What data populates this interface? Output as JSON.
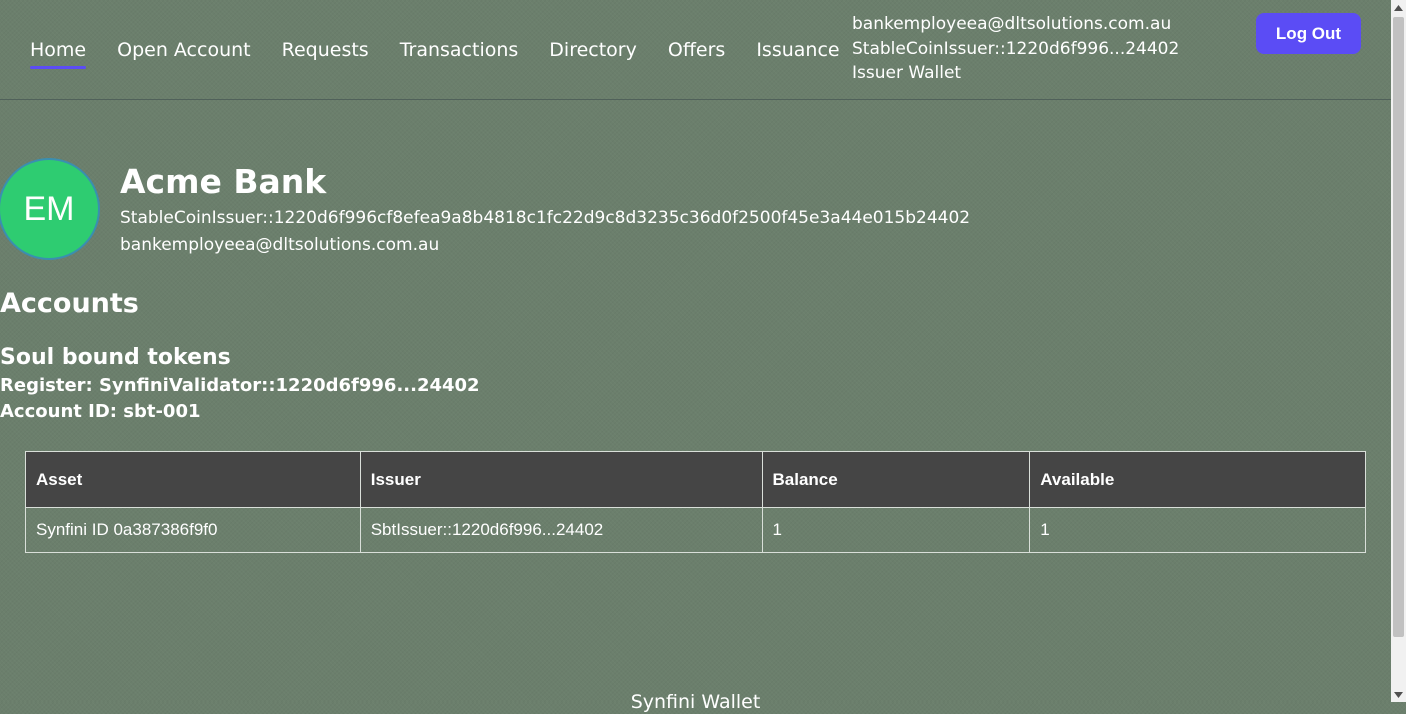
{
  "nav": {
    "items": [
      {
        "label": "Home",
        "active": true
      },
      {
        "label": "Open Account"
      },
      {
        "label": "Requests"
      },
      {
        "label": "Transactions"
      },
      {
        "label": "Directory"
      },
      {
        "label": "Offers"
      },
      {
        "label": "Issuance"
      }
    ]
  },
  "user": {
    "email": "bankemployeea@dltsolutions.com.au",
    "party": "StableCoinIssuer::1220d6f996...24402",
    "wallet": "Issuer Wallet"
  },
  "logout_label": "Log Out",
  "profile": {
    "initials": "EM",
    "name": "Acme Bank",
    "party_id": "StableCoinIssuer::1220d6f996cf8efea9a8b4818c1fc22d9c8d3235c36d0f2500f45e3a44e015b24402",
    "email": "bankemployeea@dltsolutions.com.au"
  },
  "accounts": {
    "heading": "Accounts",
    "section_title": "Soul bound tokens",
    "register": "Register: SynfiniValidator::1220d6f996...24402",
    "account_id": "Account ID: sbt-001",
    "table": {
      "headers": [
        "Asset",
        "Issuer",
        "Balance",
        "Available"
      ],
      "rows": [
        [
          "Synfini ID 0a387386f9f0",
          "SbtIssuer::1220d6f996...24402",
          "1",
          "1"
        ]
      ]
    }
  },
  "footer": "Synfini Wallet",
  "colors": {
    "accent": "#5b4cf5",
    "background": "#6b7f6c",
    "avatar": "#2ecc71",
    "table_header": "#454545"
  }
}
